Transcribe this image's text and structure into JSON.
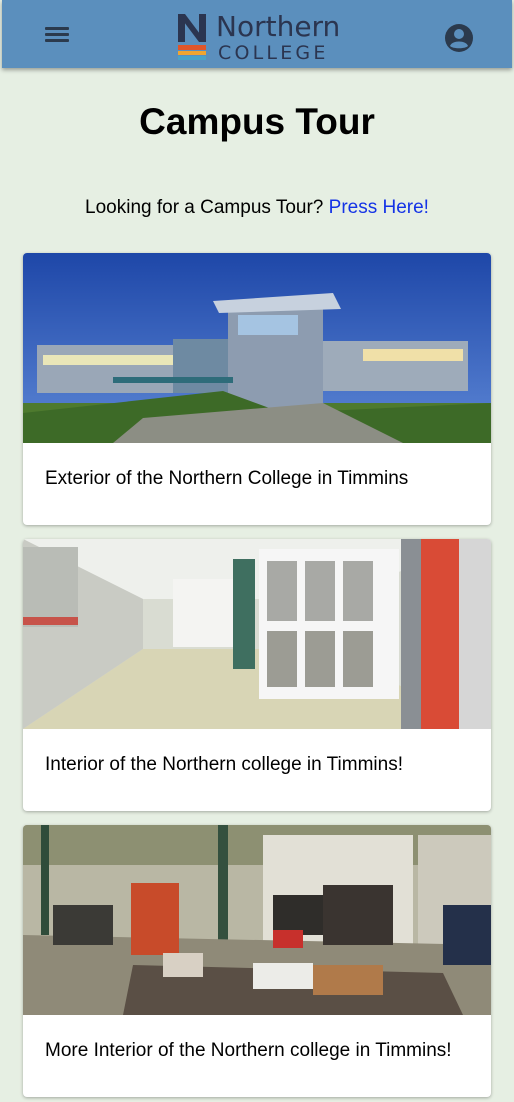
{
  "header": {
    "logo": {
      "line1": "Northern",
      "line2": "COLLEGE"
    },
    "menu_icon": "hamburger-menu-icon",
    "account_icon": "account-circle-icon",
    "bar_color": "#5b8fbd"
  },
  "page": {
    "title": "Campus Tour",
    "tour_prompt": "Looking for a Campus Tour?",
    "tour_link": "Press Here!"
  },
  "cards": [
    {
      "caption": "Exterior of the Northern College in Timmins"
    },
    {
      "caption": "Interior of the Northern college in Timmins!"
    },
    {
      "caption": "More Interior of the Northern college in Timmins!"
    }
  ],
  "colors": {
    "background": "#e6efe3",
    "link": "#1433e6"
  }
}
